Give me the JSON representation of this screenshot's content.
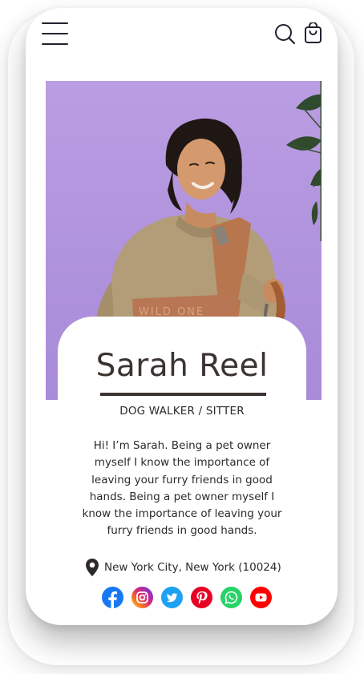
{
  "header": {
    "menu_icon": "hamburger-menu-icon",
    "search_icon": "search-icon",
    "cart_icon": "shopping-bag-icon"
  },
  "hero": {
    "strap_text": "WILD ONE"
  },
  "profile": {
    "name": "Sarah Reel",
    "role": "DOG WALKER / SITTER",
    "bio": "Hi! I’m Sarah. Being a pet owner myself I know the importance of leaving your furry friends in good hands. Being a pet owner myself I know the importance of leaving your furry friends in good hands.",
    "location": "New York City, New York (10024)"
  },
  "socials": [
    {
      "name": "facebook",
      "icon": "facebook-icon",
      "color": "#1877f2"
    },
    {
      "name": "instagram",
      "icon": "instagram-icon",
      "color": "#d62976"
    },
    {
      "name": "twitter",
      "icon": "twitter-icon",
      "color": "#1da1f2"
    },
    {
      "name": "pinterest",
      "icon": "pinterest-icon",
      "color": "#e60023"
    },
    {
      "name": "whatsapp",
      "icon": "whatsapp-icon",
      "color": "#25d366"
    },
    {
      "name": "youtube",
      "icon": "youtube-icon",
      "color": "#ff0000"
    }
  ],
  "colors": {
    "hero_background": "#b497df",
    "text": "#2b2b2b",
    "name": "#3a3330"
  }
}
